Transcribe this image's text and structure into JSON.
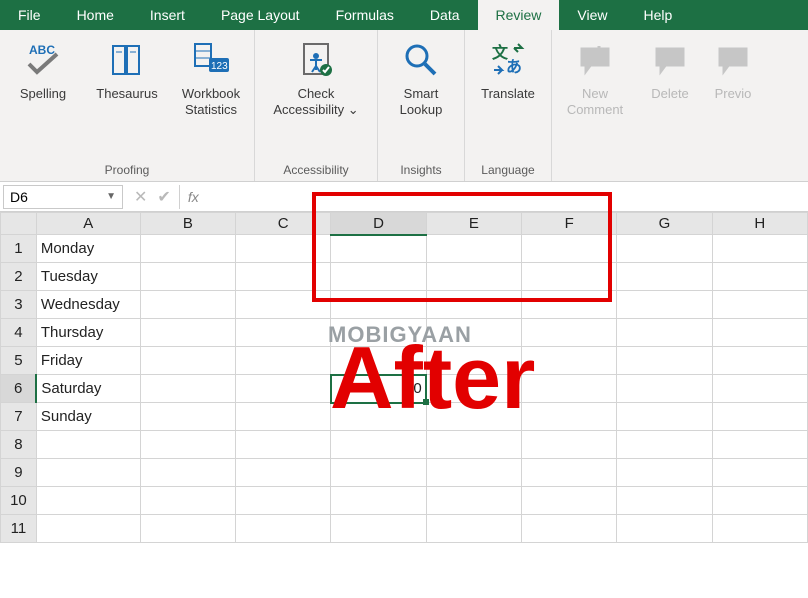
{
  "tabs": {
    "file": "File",
    "home": "Home",
    "insert": "Insert",
    "pagelayout": "Page Layout",
    "formulas": "Formulas",
    "data": "Data",
    "review": "Review",
    "view": "View",
    "help": "Help"
  },
  "ribbon": {
    "spelling": "Spelling",
    "thesaurus": "Thesaurus",
    "workbook_stats": "Workbook\nStatistics",
    "check_access": "Check\nAccessibility ⌄",
    "smart_lookup": "Smart\nLookup",
    "translate": "Translate",
    "new_comment": "New\nComment",
    "delete": "Delete",
    "previous": "Previo",
    "group_proofing": "Proofing",
    "group_access": "Accessibility",
    "group_insights": "Insights",
    "group_language": "Language"
  },
  "fbar": {
    "namebox": "D6",
    "fx": "fx",
    "formula": ""
  },
  "columns": [
    "A",
    "B",
    "C",
    "D",
    "E",
    "F",
    "G",
    "H"
  ],
  "rows": [
    "1",
    "2",
    "3",
    "4",
    "5",
    "6",
    "7",
    "8",
    "9",
    "10",
    "11"
  ],
  "cells": {
    "A1": "Monday",
    "A2": "Tuesday",
    "A3": "Wednesday",
    "A4": "Thursday",
    "A5": "Friday",
    "A6": "Saturday",
    "A7": "Sunday",
    "D6": "0"
  },
  "selection": {
    "col": "D",
    "row": "6"
  },
  "overlay": {
    "watermark": "MOBIGYAAN",
    "after": "After"
  }
}
